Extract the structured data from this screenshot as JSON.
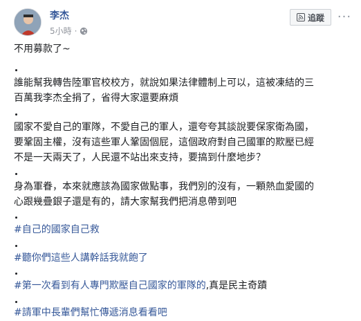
{
  "post": {
    "author": "李杰",
    "time": "5小時",
    "follow_label": "追蹤",
    "more_label": "···",
    "first_line": "不用募款了~",
    "para1": [
      "誰能幫我轉告陸軍官校校方，就說如果法律體制上可以，這被凍結的三",
      "百萬我李杰全捐了，省得大家還要麻煩"
    ],
    "para2": [
      "國家不愛自己的軍隊，不愛自己的軍人，還夸夸其談說要保家衛為國，",
      "要鞏固主權，沒有這些軍人鞏固個屁，這個政府對自己國軍的欺壓已經",
      "不是一天兩天了，人民還不站出來支持，要搞到什麼地步？"
    ],
    "para3": [
      "身為軍眷，本來就應該為國家做點事，我們別的沒有，一顆熱血愛國的",
      "心跟幾疊銀子還是有的，請大家幫我們把消息帶到吧"
    ],
    "hashtags": [
      {
        "tag": "#自己的國家自己救",
        "rest": ""
      },
      {
        "tag": "#聽你們這些人講幹話我就飽了",
        "rest": ""
      },
      {
        "tag": "#第一次看到有人專門欺壓自己國家的軍隊的",
        "rest": ",真是民主奇蹟"
      },
      {
        "tag": "#請軍中長輩們幫忙傳遞消息看看吧",
        "rest": ""
      }
    ]
  },
  "colors": {
    "link": "#365899",
    "meta": "#90949c",
    "text": "#1c1e21"
  },
  "icons": {
    "privacy": "globe-icon",
    "follow": "rss-icon",
    "avatar": "profile-photo"
  }
}
